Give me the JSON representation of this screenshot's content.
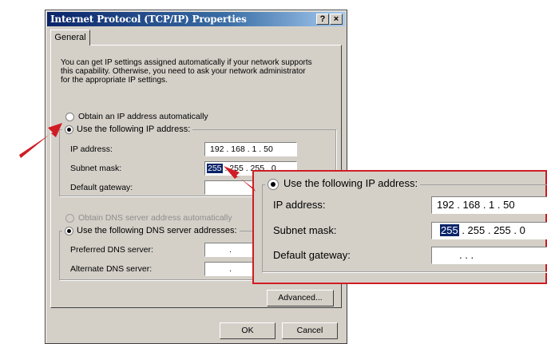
{
  "dialog": {
    "title": "Internet Protocol (TCP/IP) Properties",
    "help_button": "?",
    "close_button": "×",
    "tab_general": "General",
    "intro_text": "You can get IP settings assigned automatically if your network supports this capability. Otherwise, you need to ask your network administrator for the appropriate IP settings.",
    "ip_auto_label": "Obtain an IP address automatically",
    "ip_manual_label": "Use the following IP address:",
    "ip_address_label": "IP address:",
    "ip_address_value": "192 . 168 .  1  .  50",
    "subnet_label": "Subnet mask:",
    "subnet_first_octet": "255",
    "subnet_rest": " . 255 . 255 .  0",
    "gateway_label": "Default gateway:",
    "dns_auto_label": "Obtain DNS server address automatically",
    "dns_manual_label": "Use the following DNS server addresses:",
    "preferred_dns_label": "Preferred DNS server:",
    "alternate_dns_label": "Alternate DNS server:",
    "dns_dots": ".",
    "advanced_button": "Advanced...",
    "ok_button": "OK",
    "cancel_button": "Cancel"
  },
  "callout": {
    "legend": "Use the following IP address:",
    "ip_address_label": "IP address:",
    "ip_address_value": "192 . 168 .  1  .  50",
    "subnet_label": "Subnet mask:",
    "subnet_first_octet": "255",
    "subnet_rest": " . 255 . 255 .  0",
    "gateway_label": "Default gateway:",
    "gateway_value": ".          .          ."
  },
  "colors": {
    "title_bar": "#0a246a",
    "dialog_face": "#d4d0c8",
    "highlight": "#0a246a",
    "arrow_red": "#d01c24"
  }
}
